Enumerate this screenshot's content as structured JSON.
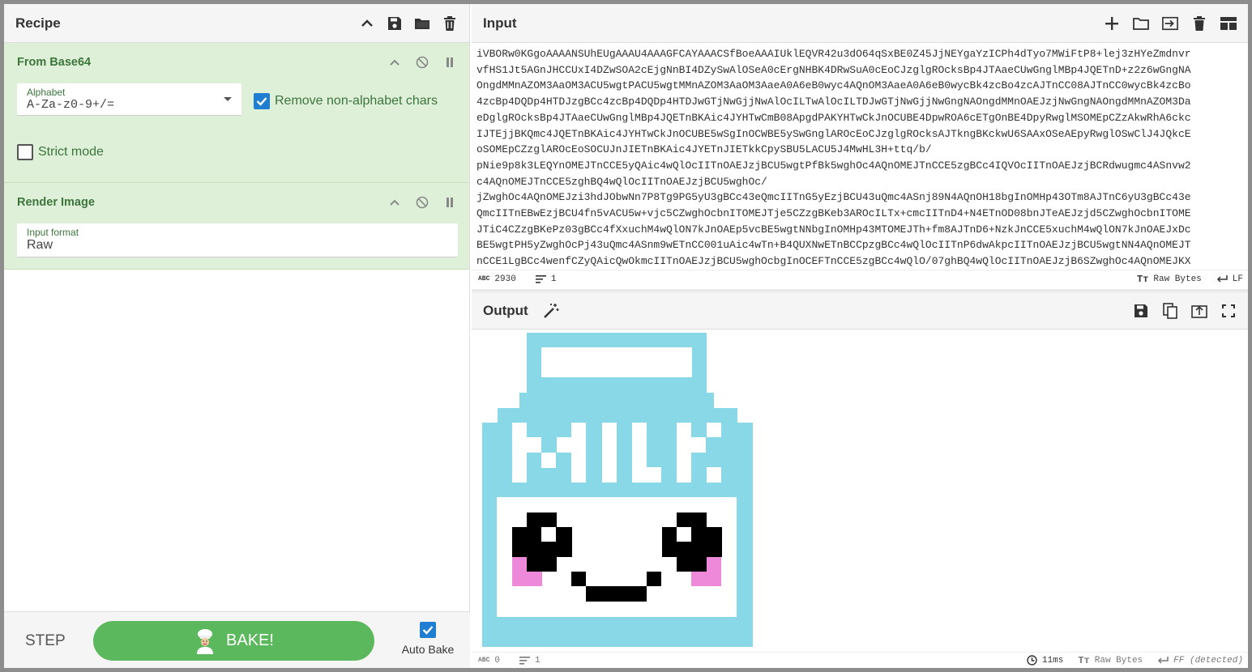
{
  "recipe": {
    "title": "Recipe",
    "operations": [
      {
        "name": "From Base64",
        "alphabet_label": "Alphabet",
        "alphabet_value": "A-Za-z0-9+/=",
        "remove_label": "Remove non-alphabet chars",
        "strict_label": "Strict mode"
      },
      {
        "name": "Render Image",
        "format_label": "Input format",
        "format_value": "Raw"
      }
    ],
    "controls": {
      "step": "STEP",
      "bake": "BAKE!",
      "autobake": "Auto Bake"
    }
  },
  "input": {
    "title": "Input",
    "lines": [
      "iVBORw0KGgoAAAANSUhEUgAAAU4AAAGFCAYAAACSfBoeAAAIUklEQVR42u3dO64qSxBE0Z45JjNEYgaYzICPh4dTyo7MWiFtP8+lej3zHYeZmdnvr",
      "vfHS1Jt5AGnJHCCUxI4DZwSOA2cEjgNnBI4DZySwAlOSeA0cErgNHBK4DRwSuA0cEoCJzglgROcksBp4JTAaeCUwGnglMBp4JQETnD+z2z6wGngNA",
      "OngdMMnAZOM3AaOM3ACU5wgtPACU5wgtMMnAZOM3AaOM3AaeA0A6eB0wyc4AQnOM3AaeA0A6eB0wycBk4zcBo4zcAJTnCC08AJTnCC0wycBk4zcBo",
      "4zcBp4DQDp4HTDJzgBCc4zcBp4DQDp4HTDJwGTjNwGjjNwAlOcILTwAlOcILTDJwGTjNwGjjNwGngNAOngdMMnOAEJzjNwGngNAOngdMMnAZOM3Da",
      "eDglgROcksBp4JTAaeCUwGnglMBp4JQETnBKAic4JYHTwCmB08ApgdPAKYHTwCkJnOCUBE4DpwROA6cETgOnBE4DpyRwglMSOMEpCZzAkwRhA6ckc",
      "IJTEjjBKQmc4JQETnBKAic4JYHTwCkJnOCUBE5wSgInOCWBE5ySwGnglAROcEoCJzglgROcksAJTkngBKckwU6SAAxOSeAEpyRwglOSwClJ4JQkcE",
      "oSOMEpCZzglAROcEoSOCUJnJIETnBKAic4JYETnJIETkkCpySBU5LACU5J4MwHL3H+ttq/b/",
      "pNie9p8k3LEQYnOMEJTnCCE5yQAic4wQlOcIITnOAEJzjBCU5wgtPfBk5wghOc4AQnOMEJTnCCE5zgBCc4IQVOcIITnOAEJzjBCRdwugmc4ASnvw2",
      "c4AQnOMEJTnCCE5zghBQ4wQlOcIITnOAEJzjBCU5wghOc/",
      "jZwghOc4AQnOMEJzi3hdJObwNn7P8Tg9PG5yU3gBCc43eQmcIITnG5yEzjBCU43uQmc4ASnj89N4AQnOH18bgInOMHp43OTm8AJTnC6yU3gBCc43e",
      "QmcIITnEBwEzjBCU4fn5vACU5w+vjc5CZwghOcbnITOMEJTje5CZzgBKeb3AROcILTx+cmcIITnD4+N4ETnOD08bnJTeAEJzjd5CZwghOcbnITOME",
      "JTiC4CZzgBKePz03gBCc4fXxuchM4wQlON7kJnOAEp5vcBE5wgtNNbgInOMHp43MTOMEJTh+fm8AJTnD6+NzkJnCCE5xuchM4wQlON7kJnOAEJxDc",
      "BE5wgtPH5yZwghOcPj43uQmc4ASnm9wETnCC001uAic4wTn+B4QUXNwETnBCCpzgBCc4wQlOcIITnP6dwAkpcIITnOAEJzjBCU5wgtNN4AQnOMEJT",
      "nCCE1LgBCc4wenfCZyQAicQwOkmcIITnOAEJzjBCU5wghOcbgInOCEFTnCCE5zgBCc4wQlO/07ghBQ4wQlOcIITnOAEJzjB6SZwghOc4AQnOMEJKX"
    ],
    "char_count": "2930",
    "line_count": "1",
    "format": "Raw Bytes",
    "eol": "LF"
  },
  "output": {
    "title": "Output",
    "char_count": "0",
    "line_count": "1",
    "time": "11ms",
    "format": "Raw Bytes",
    "eol": "FF (detected)"
  },
  "colors": {
    "milk_blue": "#88d8e8",
    "blush_pink": "#ee88d8",
    "operation_bg": "#dff0d8",
    "bake_green": "#5cb85c",
    "checkbox_blue": "#1f7ed1"
  }
}
